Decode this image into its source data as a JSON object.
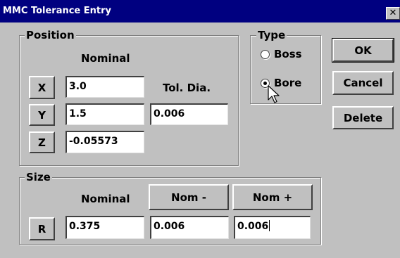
{
  "window": {
    "title": "MMC Tolerance Entry",
    "close_glyph": "✕"
  },
  "position": {
    "legend": "Position",
    "nominal_header": "Nominal",
    "tol_dia_header": "Tol. Dia.",
    "x": {
      "label": "X",
      "value": "3.0"
    },
    "y": {
      "label": "Y",
      "value": "1.5",
      "tol_dia": "0.006"
    },
    "z": {
      "label": "Z",
      "value": "-0.05573"
    }
  },
  "type": {
    "legend": "Type",
    "options": [
      {
        "label": "Boss",
        "selected": false
      },
      {
        "label": "Bore",
        "selected": true
      }
    ]
  },
  "buttons": {
    "ok": "OK",
    "cancel": "Cancel",
    "delete": "Delete"
  },
  "size": {
    "legend": "Size",
    "nominal_header": "Nominal",
    "nom_minus_label": "Nom -",
    "nom_plus_label": "Nom +",
    "r": {
      "label": "R",
      "nominal": "0.375",
      "nom_minus": "0.006",
      "nom_plus": "0.006"
    }
  },
  "icons": {
    "close": "close-icon",
    "cursor": "mouse-pointer-icon"
  },
  "colors": {
    "titlebar": "#000080",
    "face": "#c0c0c0",
    "field": "#ffffff"
  }
}
